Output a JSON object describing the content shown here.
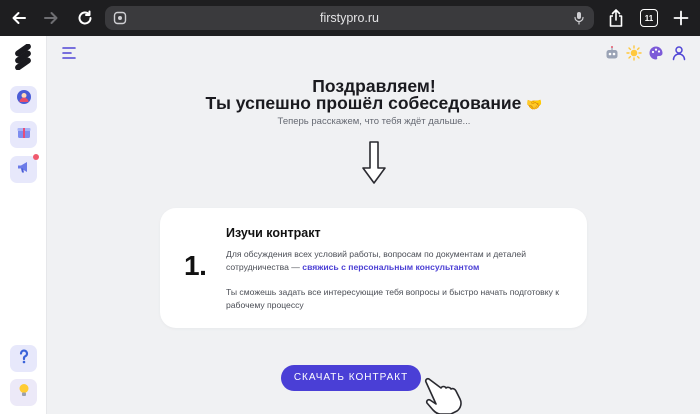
{
  "browser": {
    "url": "firstypro.ru",
    "tab_count": "11"
  },
  "main": {
    "title_line1": "Поздравляем!",
    "title_line2": "Ты успешно прошёл собеседование",
    "title_emoji": "🤝",
    "subtitle": "Теперь расскажем, что тебя ждёт дальше...",
    "step": {
      "number": "1.",
      "title": "Изучи контракт",
      "text1_before": "Для обсуждения всех условий работы, вопросам по документам и деталей сотрудничества — ",
      "text1_link": "свяжись с персональным консультантом",
      "text2": "Ты сможешь задать все интересующие тебя вопросы и быстро начать подготовку к рабочему процессу"
    },
    "cta_label": "СКАЧАТЬ КОНТРАКТ"
  },
  "colors": {
    "accent": "#4a3fd6",
    "page_bg": "#f0f1f3",
    "chrome_bg": "#1e1e20"
  }
}
